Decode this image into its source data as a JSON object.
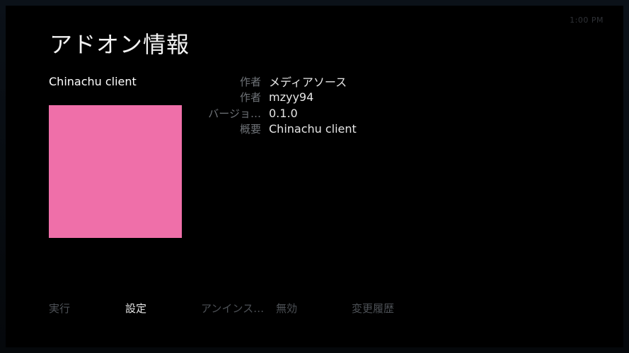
{
  "header": {
    "title": "アドオン情報",
    "clock": "1:00 PM"
  },
  "addon": {
    "name": "Chinachu client",
    "thumbnail_color": "#ef6fa9"
  },
  "info": [
    {
      "label": "作者",
      "value": "メディアソース"
    },
    {
      "label": "作者",
      "value": "mzyy94"
    },
    {
      "label": "バージョ…",
      "value": "0.1.0"
    },
    {
      "label": "概要",
      "value": "Chinachu client"
    }
  ],
  "menu": {
    "run": "実行",
    "settings": "設定",
    "uninstall": "アンインス…",
    "disable": "無効",
    "changelog": "変更履歴"
  }
}
